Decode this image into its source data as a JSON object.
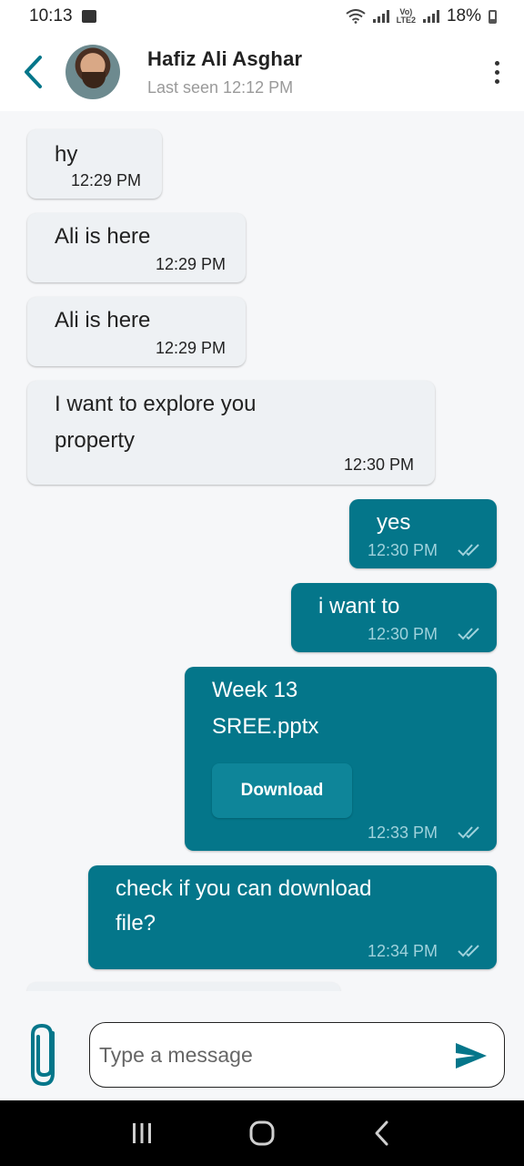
{
  "status_bar": {
    "time": "10:13",
    "battery": "18%"
  },
  "header": {
    "contact_name": "Hafiz Ali Asghar",
    "last_seen": "Last seen 12:12 PM"
  },
  "messages": [
    {
      "direction": "in",
      "text": "hy",
      "time": "12:29 PM"
    },
    {
      "direction": "in",
      "text": "Ali is here",
      "time": "12:29 PM"
    },
    {
      "direction": "in",
      "text": "Ali is here",
      "time": "12:29 PM"
    },
    {
      "direction": "in",
      "text_line1": "I want to explore you",
      "text_line2": "property",
      "time": "12:30 PM"
    },
    {
      "direction": "out",
      "text": "yes",
      "time": "12:30 PM",
      "status": "read-double-check"
    },
    {
      "direction": "out",
      "text": "i want to",
      "time": "12:30 PM",
      "status": "read-double-check"
    },
    {
      "direction": "out",
      "file_line1": "Week 13",
      "file_line2": "SREE.pptx",
      "button_label": "Download",
      "time": "12:33 PM",
      "status": "read-double-check"
    },
    {
      "direction": "out",
      "text_line1": "check if you can download",
      "text_line2": "file?",
      "time": "12:34 PM",
      "status": "read-double-check"
    }
  ],
  "composer": {
    "placeholder": "Type a message"
  },
  "colors": {
    "accent": "#04768a",
    "incoming_bubble": "#eef1f4",
    "background": "#f6f7f9"
  },
  "icons": {
    "back": "chevron-left-icon",
    "more": "more-vertical-icon",
    "attach": "paperclip-icon",
    "send": "send-icon",
    "nav_recents": "recents-icon",
    "nav_home": "home-icon",
    "nav_back": "back-icon"
  }
}
